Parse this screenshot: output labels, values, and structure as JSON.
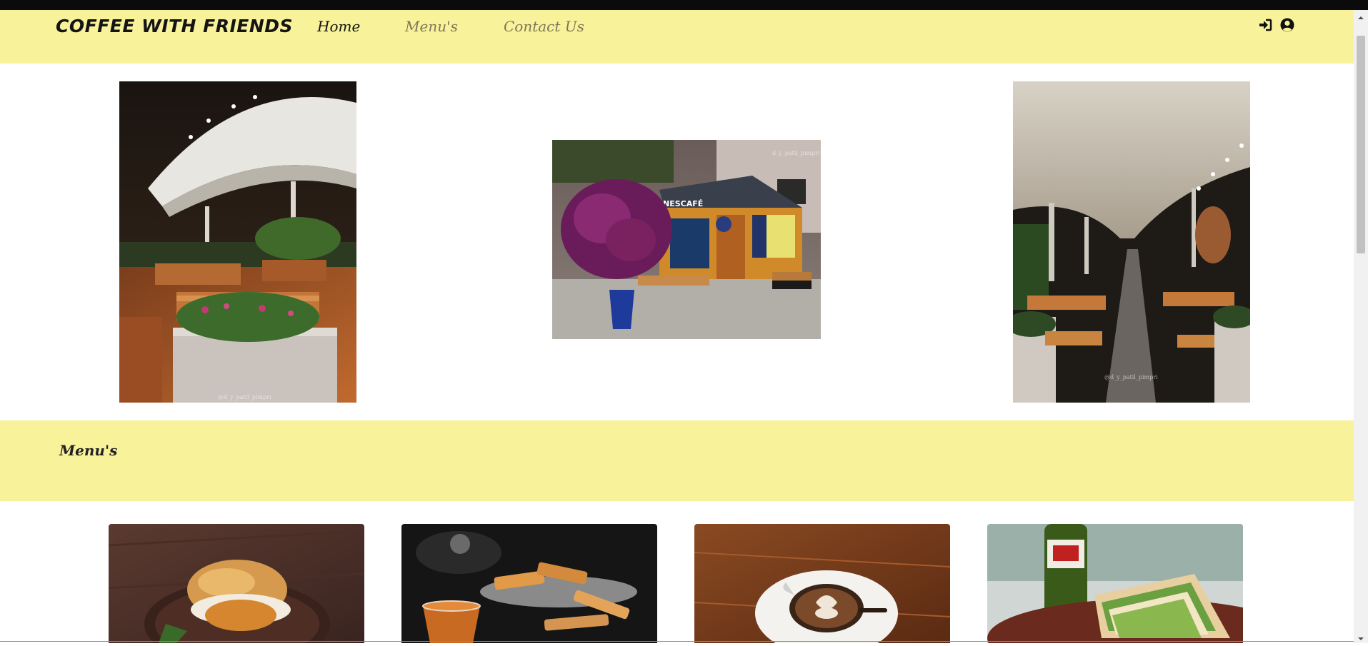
{
  "navbar": {
    "brand": "COFFEE WITH FRIENDS",
    "links": [
      {
        "label": "Home",
        "active": true
      },
      {
        "label": "Menu's",
        "active": false
      },
      {
        "label": "Contact Us",
        "active": false
      }
    ],
    "icons": [
      "sign-in-icon",
      "user-circle-icon"
    ],
    "background": "#f8f29b"
  },
  "gallery": {
    "watermarks": [
      "@d_y_patil_pimpri",
      "d_y_patil_pimpri",
      "@d_y_patil_pimpri"
    ]
  },
  "menu_section": {
    "title": "Menu's"
  },
  "menu_cards": [
    {
      "image": "vada-pav-photo"
    },
    {
      "image": "tea-and-rusk-photo"
    },
    {
      "image": "cappuccino-photo"
    },
    {
      "image": "sandwich-photo"
    }
  ]
}
